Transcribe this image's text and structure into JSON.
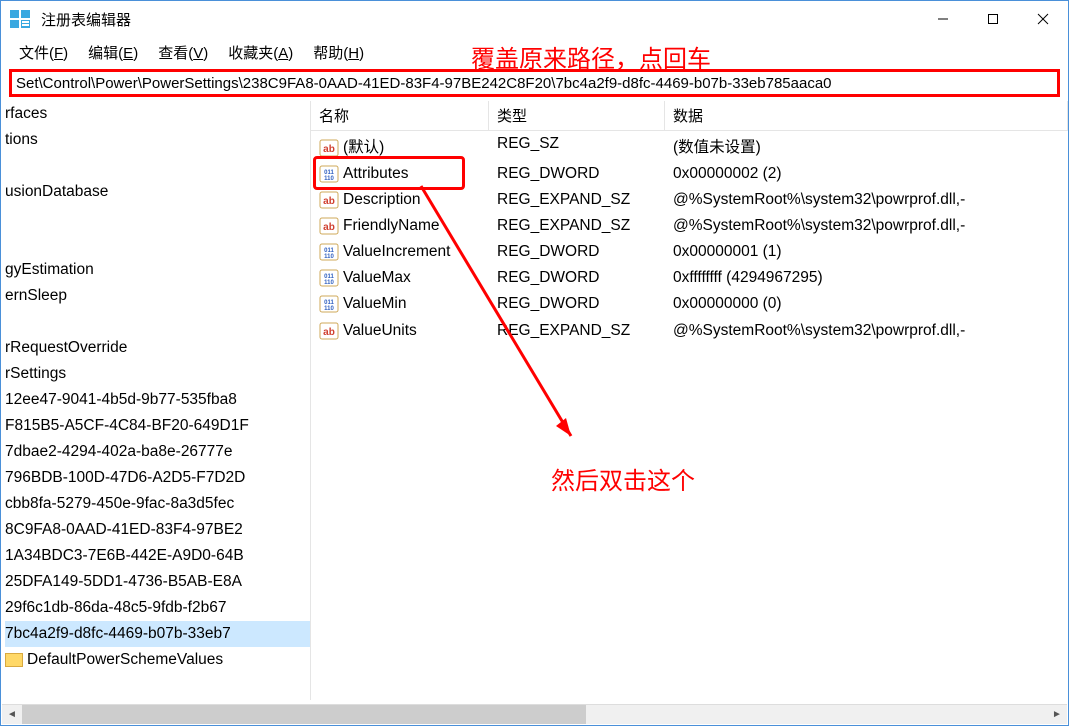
{
  "window": {
    "title": "注册表编辑器"
  },
  "menu": {
    "file": "文件(F)",
    "edit": "编辑(E)",
    "view": "查看(V)",
    "favorites": "收藏夹(A)",
    "help": "帮助(H)"
  },
  "address": {
    "path": "Set\\Control\\Power\\PowerSettings\\238C9FA8-0AAD-41ED-83F4-97BE242C8F20\\7bc4a2f9-d8fc-4469-b07b-33eb785aaca0"
  },
  "tree": {
    "items": [
      {
        "label": "rfaces"
      },
      {
        "label": "tions"
      },
      {
        "label": ""
      },
      {
        "label": "usionDatabase"
      },
      {
        "label": ""
      },
      {
        "label": ""
      },
      {
        "label": "gyEstimation"
      },
      {
        "label": "ernSleep"
      },
      {
        "label": ""
      },
      {
        "label": "rRequestOverride"
      },
      {
        "label": "rSettings"
      },
      {
        "label": "12ee47-9041-4b5d-9b77-535fba8"
      },
      {
        "label": "F815B5-A5CF-4C84-BF20-649D1F"
      },
      {
        "label": "7dbae2-4294-402a-ba8e-26777e"
      },
      {
        "label": "796BDB-100D-47D6-A2D5-F7D2D"
      },
      {
        "label": "cbb8fa-5279-450e-9fac-8a3d5fec"
      },
      {
        "label": "8C9FA8-0AAD-41ED-83F4-97BE2"
      },
      {
        "label": "1A34BDC3-7E6B-442E-A9D0-64B"
      },
      {
        "label": "25DFA149-5DD1-4736-B5AB-E8A"
      },
      {
        "label": "29f6c1db-86da-48c5-9fdb-f2b67"
      },
      {
        "label": "7bc4a2f9-d8fc-4469-b07b-33eb7",
        "selected": true
      },
      {
        "label": "DefaultPowerSchemeValues",
        "folder": true
      }
    ]
  },
  "list": {
    "headers": {
      "name": "名称",
      "type": "类型",
      "data": "数据"
    },
    "rows": [
      {
        "icon": "str",
        "name": "(默认)",
        "type": "REG_SZ",
        "data": "(数值未设置)"
      },
      {
        "icon": "bin",
        "name": "Attributes",
        "type": "REG_DWORD",
        "data": "0x00000002 (2)",
        "highlight": true
      },
      {
        "icon": "str",
        "name": "Description",
        "type": "REG_EXPAND_SZ",
        "data": "@%SystemRoot%\\system32\\powrprof.dll,-"
      },
      {
        "icon": "str",
        "name": "FriendlyName",
        "type": "REG_EXPAND_SZ",
        "data": "@%SystemRoot%\\system32\\powrprof.dll,-"
      },
      {
        "icon": "bin",
        "name": "ValueIncrement",
        "type": "REG_DWORD",
        "data": "0x00000001 (1)"
      },
      {
        "icon": "bin",
        "name": "ValueMax",
        "type": "REG_DWORD",
        "data": "0xffffffff (4294967295)"
      },
      {
        "icon": "bin",
        "name": "ValueMin",
        "type": "REG_DWORD",
        "data": "0x00000000 (0)"
      },
      {
        "icon": "str",
        "name": "ValueUnits",
        "type": "REG_EXPAND_SZ",
        "data": "@%SystemRoot%\\system32\\powrprof.dll,-"
      }
    ]
  },
  "annotations": {
    "top": "覆盖原来路径，点回车",
    "mid": "然后双击这个"
  }
}
